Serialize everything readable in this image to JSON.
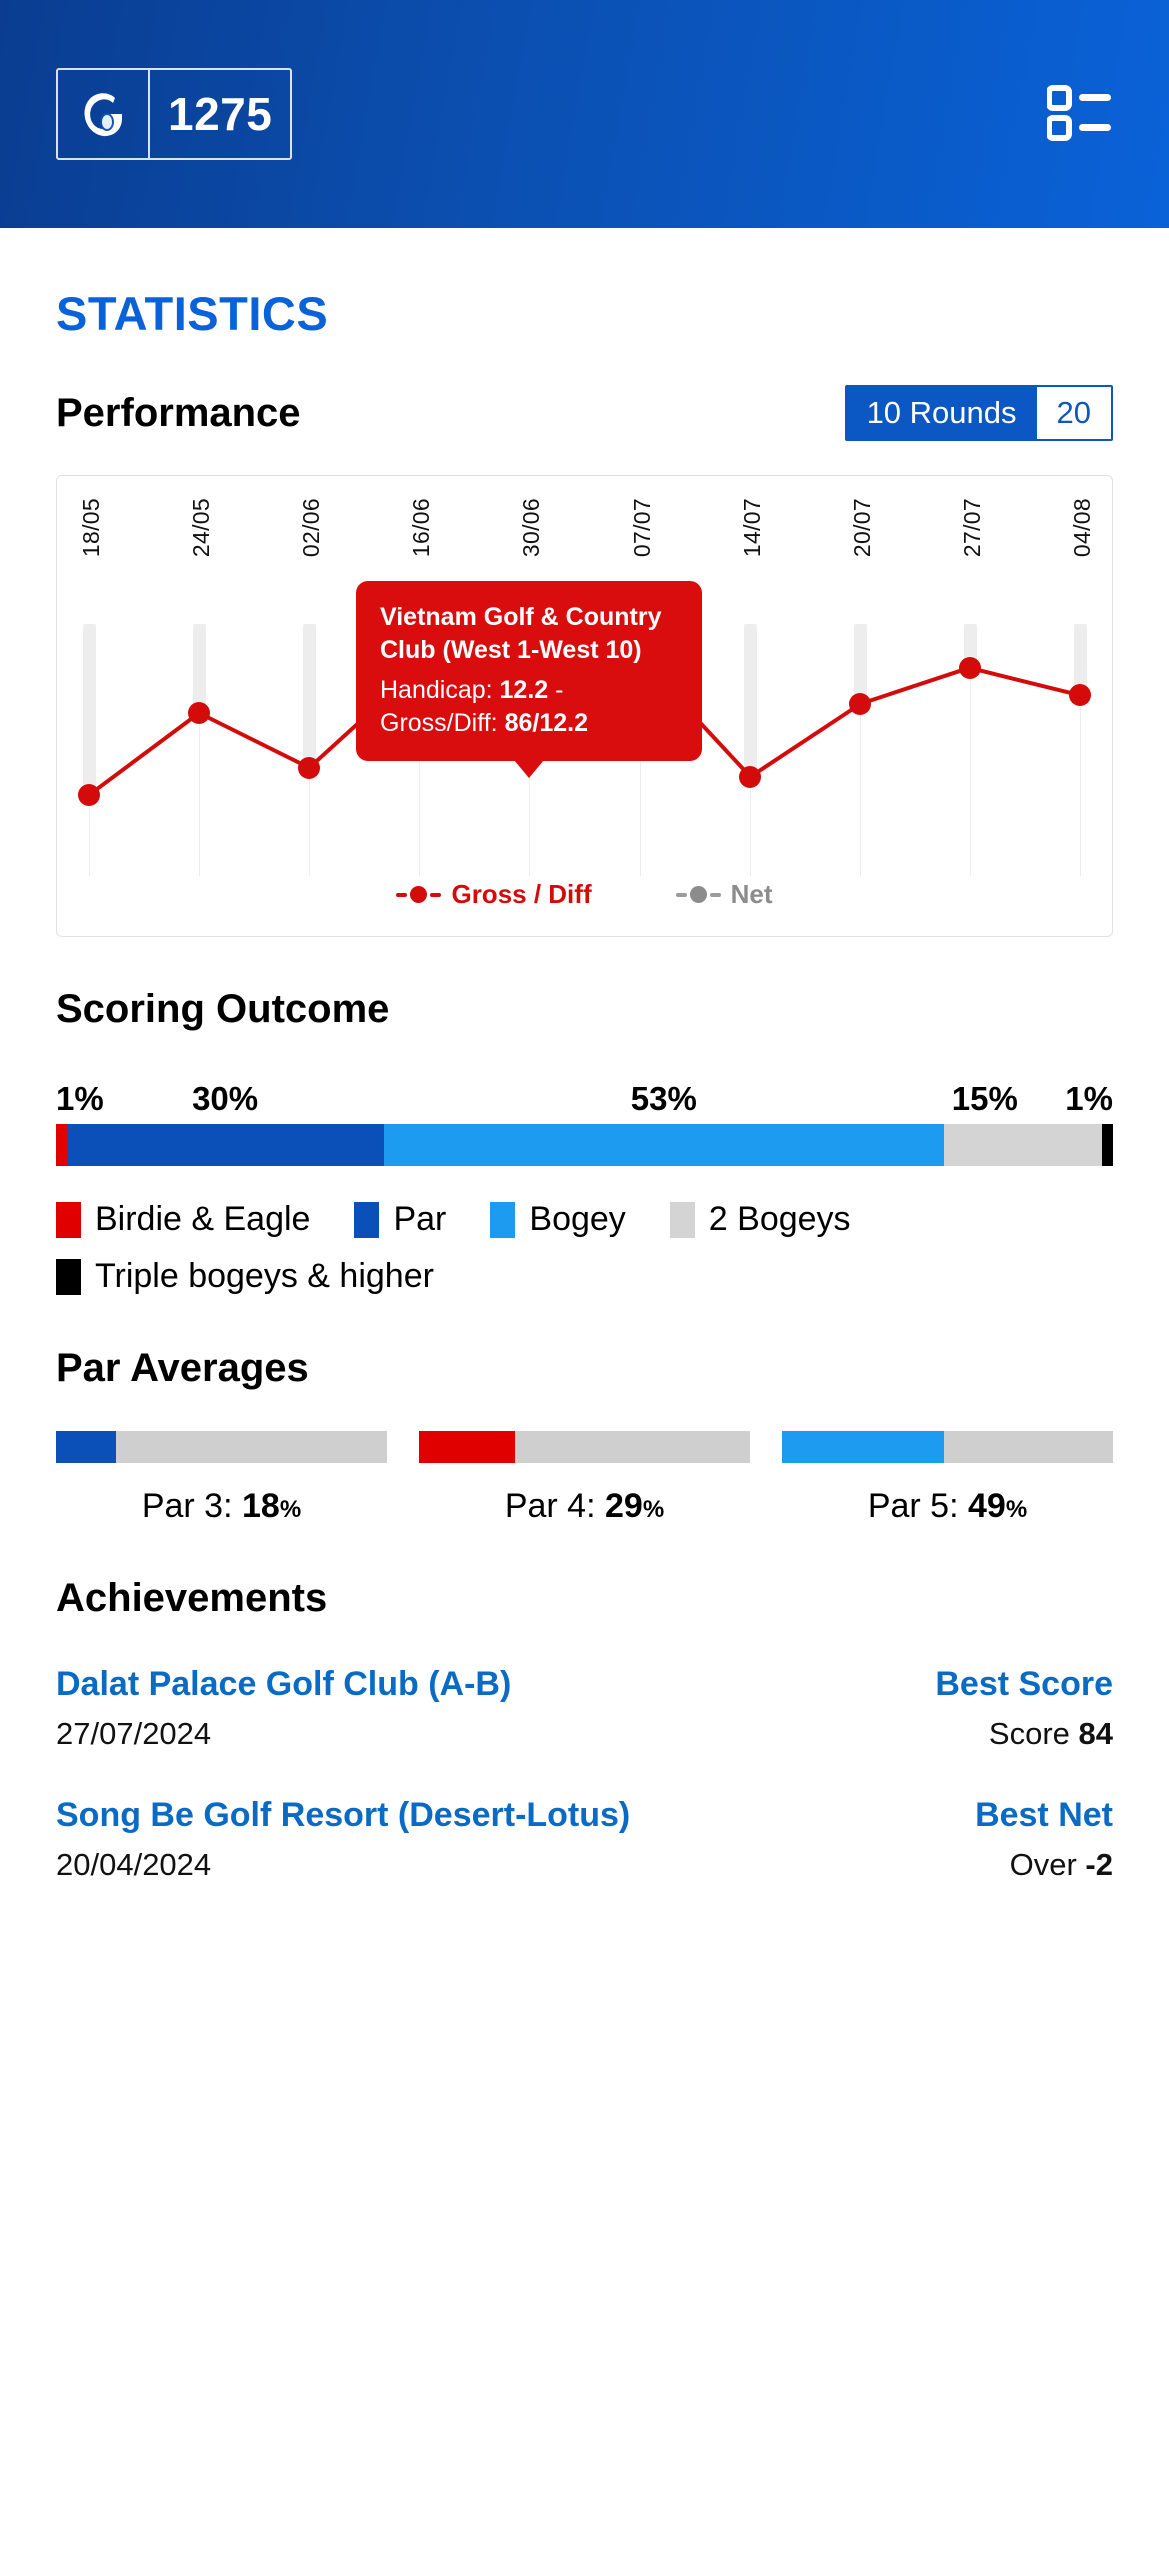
{
  "header": {
    "logo_letter": "G",
    "count": "1275",
    "menu_icon": "list-icon"
  },
  "page_title": "STATISTICS",
  "performance": {
    "title": "Performance",
    "rounds_toggle": {
      "selected": "10 Rounds",
      "options": [
        "10 Rounds",
        "20"
      ]
    }
  },
  "tooltip": {
    "course": "Vietnam Golf & Country Club (West 1-West 10)",
    "prefix_handicap": "Handicap: ",
    "handicap": "12.2",
    "separator": " - Gross/Diff: ",
    "gross_diff": "86/12.2"
  },
  "chart_legend": [
    {
      "label": "Gross / Diff",
      "color": "#d40b0b"
    },
    {
      "label": "Net",
      "color": "#8c8c8c"
    }
  ],
  "scoring": {
    "title": "Scoring Outcome",
    "labels": [
      "1%",
      "30%",
      "53%",
      "15%",
      "1%"
    ],
    "legend": [
      {
        "label": "Birdie & Eagle",
        "color": "#e00000"
      },
      {
        "label": "Par",
        "color": "#0b4fb8"
      },
      {
        "label": "Bogey",
        "color": "#1d9bf0"
      },
      {
        "label": "2 Bogeys",
        "color": "#d4d4d4"
      },
      {
        "label": "Triple bogeys & higher",
        "color": "#000000"
      }
    ]
  },
  "par_averages": {
    "title": "Par Averages",
    "items": [
      {
        "label": "Par 3: ",
        "value": "18",
        "unit": "%",
        "percent": 18,
        "color": "#0b4fb8"
      },
      {
        "label": "Par 4: ",
        "value": "29",
        "unit": "%",
        "percent": 29,
        "color": "#e00000"
      },
      {
        "label": "Par 5: ",
        "value": "49",
        "unit": "%",
        "percent": 49,
        "color": "#1d9bf0"
      }
    ]
  },
  "achievements": {
    "title": "Achievements",
    "items": [
      {
        "course": "Dalat Palace Golf Club (A-B)",
        "date": "27/07/2024",
        "tag": "Best Score",
        "value_label": "Score ",
        "value": "84"
      },
      {
        "course": "Song Be Golf Resort (Desert-Lotus)",
        "date": "20/04/2024",
        "tag": "Best Net",
        "value_label": "Over ",
        "value": "-2"
      }
    ]
  },
  "chart_data": {
    "type": "line",
    "title": "Performance",
    "xlabel": "",
    "ylabel": "",
    "categories": [
      "18/05",
      "24/05",
      "02/06",
      "16/06",
      "30/06",
      "07/07",
      "14/07",
      "20/07",
      "27/07",
      "04/08"
    ],
    "series": [
      {
        "name": "Gross / Diff",
        "color": "#d40b0b",
        "values": [
          11.1,
          12.0,
          11.4,
          12.5,
          13.0,
          12.6,
          11.3,
          12.1,
          12.5,
          12.2
        ]
      },
      {
        "name": "Net",
        "color": "#8c8c8c",
        "values": []
      }
    ],
    "highlighted_index": 4,
    "grid": true,
    "legend_position": "bottom"
  }
}
